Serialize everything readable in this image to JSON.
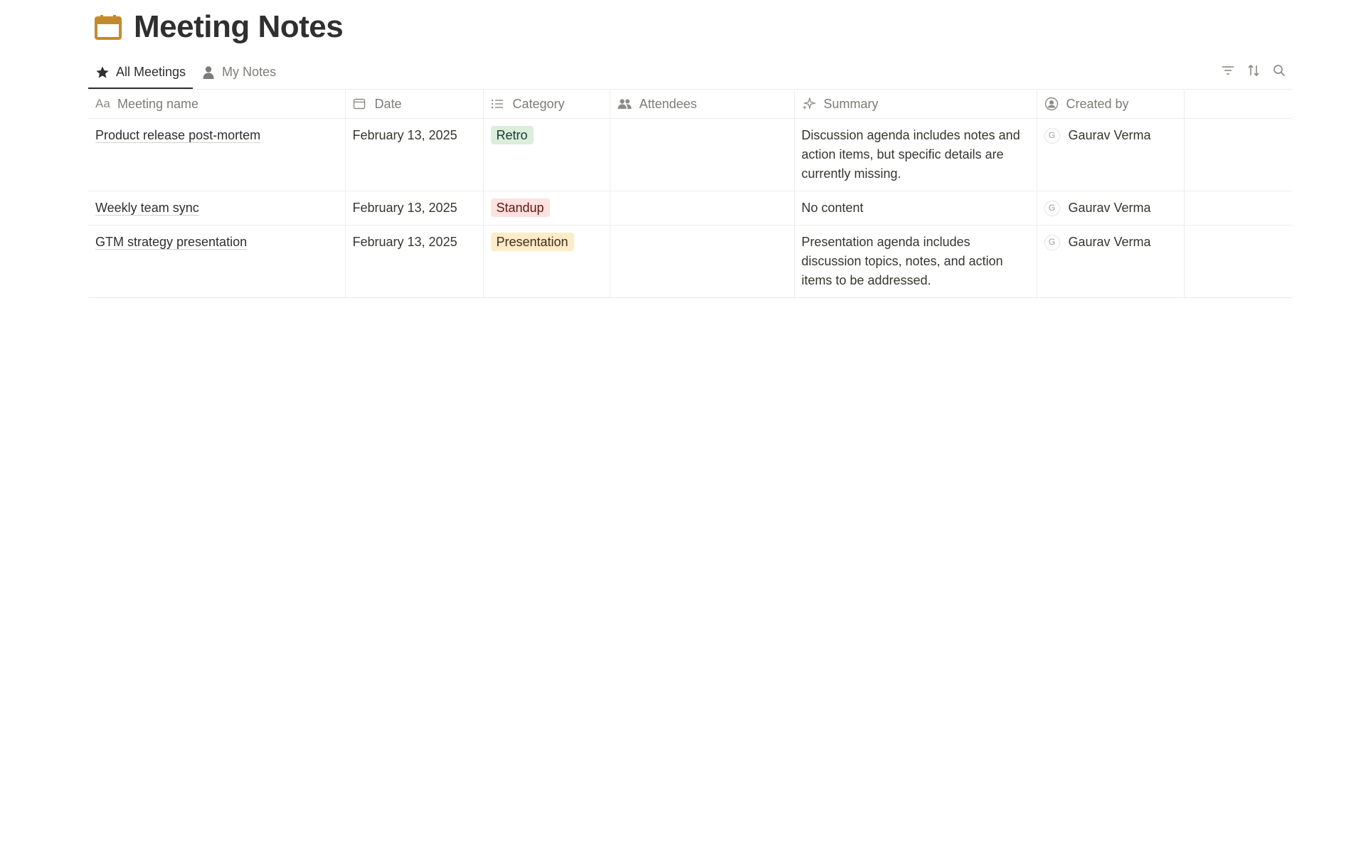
{
  "page": {
    "title": "Meeting Notes",
    "icon": "calendar-icon",
    "icon_color": "#c38a2d"
  },
  "tabs": [
    {
      "label": "All Meetings",
      "icon": "star-icon",
      "active": true
    },
    {
      "label": "My Notes",
      "icon": "person-icon",
      "active": false
    }
  ],
  "toolbar": {
    "filter_icon": "filter-icon",
    "sort_icon": "sort-icon",
    "search_icon": "search-icon"
  },
  "columns": [
    {
      "label": "Meeting name",
      "icon": "text-type-icon",
      "icon_text": "Aa"
    },
    {
      "label": "Date",
      "icon": "calendar-small-icon"
    },
    {
      "label": "Category",
      "icon": "list-icon"
    },
    {
      "label": "Attendees",
      "icon": "people-icon"
    },
    {
      "label": "Summary",
      "icon": "sparkle-icon"
    },
    {
      "label": "Created by",
      "icon": "user-circle-icon"
    }
  ],
  "rows": [
    {
      "name": "Product release post-mortem",
      "date": "February 13, 2025",
      "category": "Retro",
      "category_bg": "#dbeddb",
      "category_fg": "#1c3829",
      "attendees": "",
      "summary": "Discussion agenda includes notes and action items, but specific details are currently missing.",
      "created_by": "Gaurav Verma",
      "created_by_initial": "G"
    },
    {
      "name": "Weekly team sync",
      "date": "February 13, 2025",
      "category": "Standup",
      "category_bg": "#ffe2dd",
      "category_fg": "#5d1715",
      "attendees": "",
      "summary": "No content",
      "created_by": "Gaurav Verma",
      "created_by_initial": "G"
    },
    {
      "name": "GTM strategy presentation",
      "date": "February 13, 2025",
      "category": "Presentation",
      "category_bg": "#fdecc8",
      "category_fg": "#402c1b",
      "attendees": "",
      "summary": "Presentation agenda includes discussion topics, notes, and action items to be addressed.",
      "created_by": "Gaurav Verma",
      "created_by_initial": "G"
    }
  ]
}
